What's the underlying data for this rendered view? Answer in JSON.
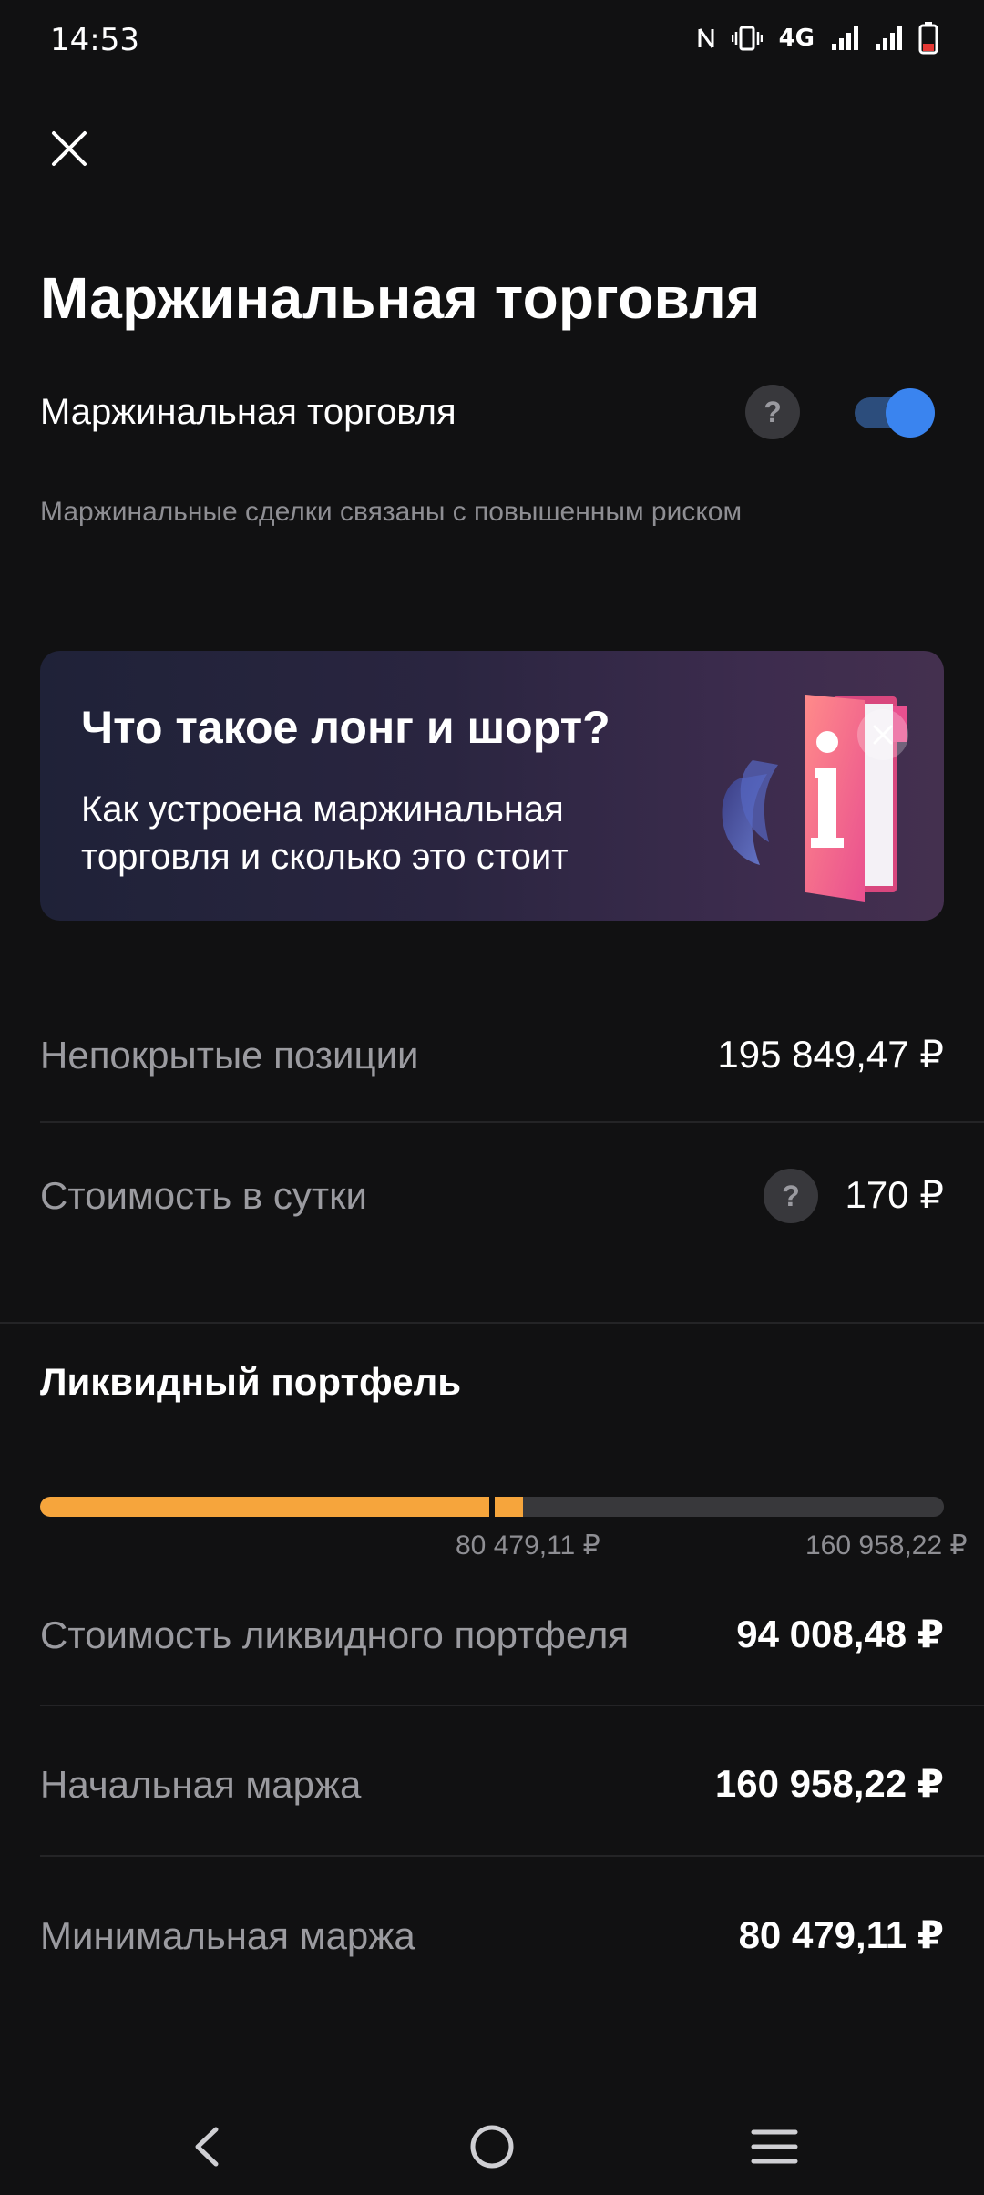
{
  "status_bar": {
    "time": "14:53",
    "network": "4G",
    "icons": [
      "nfc-icon",
      "vibrate-icon",
      "signal-icon",
      "signal-icon",
      "battery-icon"
    ]
  },
  "header": {
    "close_icon": "close-icon",
    "title": "Маржинальная торговля"
  },
  "margin_toggle": {
    "label": "Маржинальная торговля",
    "help_label": "?",
    "enabled": true,
    "hint": "Маржинальные сделки связаны с повышенным риском"
  },
  "promo": {
    "title": "Что такое лонг и шорт?",
    "text": "Как устроена маржинальная торговля и сколько это стоит",
    "art_icon": "info-book-icon"
  },
  "positions": {
    "uncovered_label": "Непокрытые позиции",
    "uncovered_value": "195 849,47 ₽",
    "fee_label": "Стоимость в сутки",
    "fee_help": "?",
    "fee_value": "170 ₽"
  },
  "liquid_portfolio": {
    "title": "Ликвидный портфель",
    "progress_fraction": 0.5341,
    "min_marker_fraction": 0.5,
    "min_label": "80 479,11 ₽",
    "init_label": "160 958,22 ₽",
    "rows": [
      {
        "label": "Стоимость ликвидного портфеля",
        "value": "94 008,48 ₽"
      },
      {
        "label": "Начальная маржа",
        "value": "160 958,22 ₽"
      },
      {
        "label": "Минимальная маржа",
        "value": "80 479,11 ₽"
      }
    ]
  },
  "colors": {
    "background": "#111112",
    "accent_blue": "#3a84ef",
    "progress_orange": "#f6a53c",
    "muted_text": "#9b9ba0"
  },
  "nav": {
    "back_icon": "back-icon",
    "home_icon": "home-icon",
    "menu_icon": "menu-icon"
  }
}
